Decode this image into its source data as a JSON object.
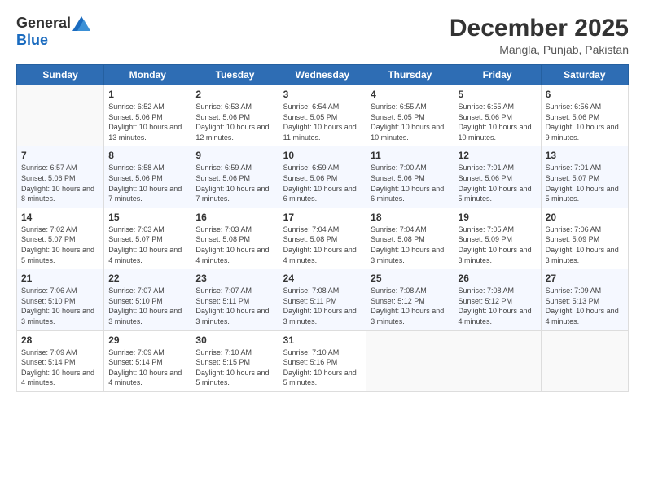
{
  "logo": {
    "general": "General",
    "blue": "Blue"
  },
  "header": {
    "title": "December 2025",
    "subtitle": "Mangla, Punjab, Pakistan"
  },
  "columns": [
    "Sunday",
    "Monday",
    "Tuesday",
    "Wednesday",
    "Thursday",
    "Friday",
    "Saturday"
  ],
  "weeks": [
    [
      {
        "day": "",
        "sunrise": "",
        "sunset": "",
        "daylight": ""
      },
      {
        "day": "1",
        "sunrise": "Sunrise: 6:52 AM",
        "sunset": "Sunset: 5:06 PM",
        "daylight": "Daylight: 10 hours and 13 minutes."
      },
      {
        "day": "2",
        "sunrise": "Sunrise: 6:53 AM",
        "sunset": "Sunset: 5:06 PM",
        "daylight": "Daylight: 10 hours and 12 minutes."
      },
      {
        "day": "3",
        "sunrise": "Sunrise: 6:54 AM",
        "sunset": "Sunset: 5:05 PM",
        "daylight": "Daylight: 10 hours and 11 minutes."
      },
      {
        "day": "4",
        "sunrise": "Sunrise: 6:55 AM",
        "sunset": "Sunset: 5:05 PM",
        "daylight": "Daylight: 10 hours and 10 minutes."
      },
      {
        "day": "5",
        "sunrise": "Sunrise: 6:55 AM",
        "sunset": "Sunset: 5:06 PM",
        "daylight": "Daylight: 10 hours and 10 minutes."
      },
      {
        "day": "6",
        "sunrise": "Sunrise: 6:56 AM",
        "sunset": "Sunset: 5:06 PM",
        "daylight": "Daylight: 10 hours and 9 minutes."
      }
    ],
    [
      {
        "day": "7",
        "sunrise": "Sunrise: 6:57 AM",
        "sunset": "Sunset: 5:06 PM",
        "daylight": "Daylight: 10 hours and 8 minutes."
      },
      {
        "day": "8",
        "sunrise": "Sunrise: 6:58 AM",
        "sunset": "Sunset: 5:06 PM",
        "daylight": "Daylight: 10 hours and 7 minutes."
      },
      {
        "day": "9",
        "sunrise": "Sunrise: 6:59 AM",
        "sunset": "Sunset: 5:06 PM",
        "daylight": "Daylight: 10 hours and 7 minutes."
      },
      {
        "day": "10",
        "sunrise": "Sunrise: 6:59 AM",
        "sunset": "Sunset: 5:06 PM",
        "daylight": "Daylight: 10 hours and 6 minutes."
      },
      {
        "day": "11",
        "sunrise": "Sunrise: 7:00 AM",
        "sunset": "Sunset: 5:06 PM",
        "daylight": "Daylight: 10 hours and 6 minutes."
      },
      {
        "day": "12",
        "sunrise": "Sunrise: 7:01 AM",
        "sunset": "Sunset: 5:06 PM",
        "daylight": "Daylight: 10 hours and 5 minutes."
      },
      {
        "day": "13",
        "sunrise": "Sunrise: 7:01 AM",
        "sunset": "Sunset: 5:07 PM",
        "daylight": "Daylight: 10 hours and 5 minutes."
      }
    ],
    [
      {
        "day": "14",
        "sunrise": "Sunrise: 7:02 AM",
        "sunset": "Sunset: 5:07 PM",
        "daylight": "Daylight: 10 hours and 5 minutes."
      },
      {
        "day": "15",
        "sunrise": "Sunrise: 7:03 AM",
        "sunset": "Sunset: 5:07 PM",
        "daylight": "Daylight: 10 hours and 4 minutes."
      },
      {
        "day": "16",
        "sunrise": "Sunrise: 7:03 AM",
        "sunset": "Sunset: 5:08 PM",
        "daylight": "Daylight: 10 hours and 4 minutes."
      },
      {
        "day": "17",
        "sunrise": "Sunrise: 7:04 AM",
        "sunset": "Sunset: 5:08 PM",
        "daylight": "Daylight: 10 hours and 4 minutes."
      },
      {
        "day": "18",
        "sunrise": "Sunrise: 7:04 AM",
        "sunset": "Sunset: 5:08 PM",
        "daylight": "Daylight: 10 hours and 3 minutes."
      },
      {
        "day": "19",
        "sunrise": "Sunrise: 7:05 AM",
        "sunset": "Sunset: 5:09 PM",
        "daylight": "Daylight: 10 hours and 3 minutes."
      },
      {
        "day": "20",
        "sunrise": "Sunrise: 7:06 AM",
        "sunset": "Sunset: 5:09 PM",
        "daylight": "Daylight: 10 hours and 3 minutes."
      }
    ],
    [
      {
        "day": "21",
        "sunrise": "Sunrise: 7:06 AM",
        "sunset": "Sunset: 5:10 PM",
        "daylight": "Daylight: 10 hours and 3 minutes."
      },
      {
        "day": "22",
        "sunrise": "Sunrise: 7:07 AM",
        "sunset": "Sunset: 5:10 PM",
        "daylight": "Daylight: 10 hours and 3 minutes."
      },
      {
        "day": "23",
        "sunrise": "Sunrise: 7:07 AM",
        "sunset": "Sunset: 5:11 PM",
        "daylight": "Daylight: 10 hours and 3 minutes."
      },
      {
        "day": "24",
        "sunrise": "Sunrise: 7:08 AM",
        "sunset": "Sunset: 5:11 PM",
        "daylight": "Daylight: 10 hours and 3 minutes."
      },
      {
        "day": "25",
        "sunrise": "Sunrise: 7:08 AM",
        "sunset": "Sunset: 5:12 PM",
        "daylight": "Daylight: 10 hours and 3 minutes."
      },
      {
        "day": "26",
        "sunrise": "Sunrise: 7:08 AM",
        "sunset": "Sunset: 5:12 PM",
        "daylight": "Daylight: 10 hours and 4 minutes."
      },
      {
        "day": "27",
        "sunrise": "Sunrise: 7:09 AM",
        "sunset": "Sunset: 5:13 PM",
        "daylight": "Daylight: 10 hours and 4 minutes."
      }
    ],
    [
      {
        "day": "28",
        "sunrise": "Sunrise: 7:09 AM",
        "sunset": "Sunset: 5:14 PM",
        "daylight": "Daylight: 10 hours and 4 minutes."
      },
      {
        "day": "29",
        "sunrise": "Sunrise: 7:09 AM",
        "sunset": "Sunset: 5:14 PM",
        "daylight": "Daylight: 10 hours and 4 minutes."
      },
      {
        "day": "30",
        "sunrise": "Sunrise: 7:10 AM",
        "sunset": "Sunset: 5:15 PM",
        "daylight": "Daylight: 10 hours and 5 minutes."
      },
      {
        "day": "31",
        "sunrise": "Sunrise: 7:10 AM",
        "sunset": "Sunset: 5:16 PM",
        "daylight": "Daylight: 10 hours and 5 minutes."
      },
      {
        "day": "",
        "sunrise": "",
        "sunset": "",
        "daylight": ""
      },
      {
        "day": "",
        "sunrise": "",
        "sunset": "",
        "daylight": ""
      },
      {
        "day": "",
        "sunrise": "",
        "sunset": "",
        "daylight": ""
      }
    ]
  ]
}
